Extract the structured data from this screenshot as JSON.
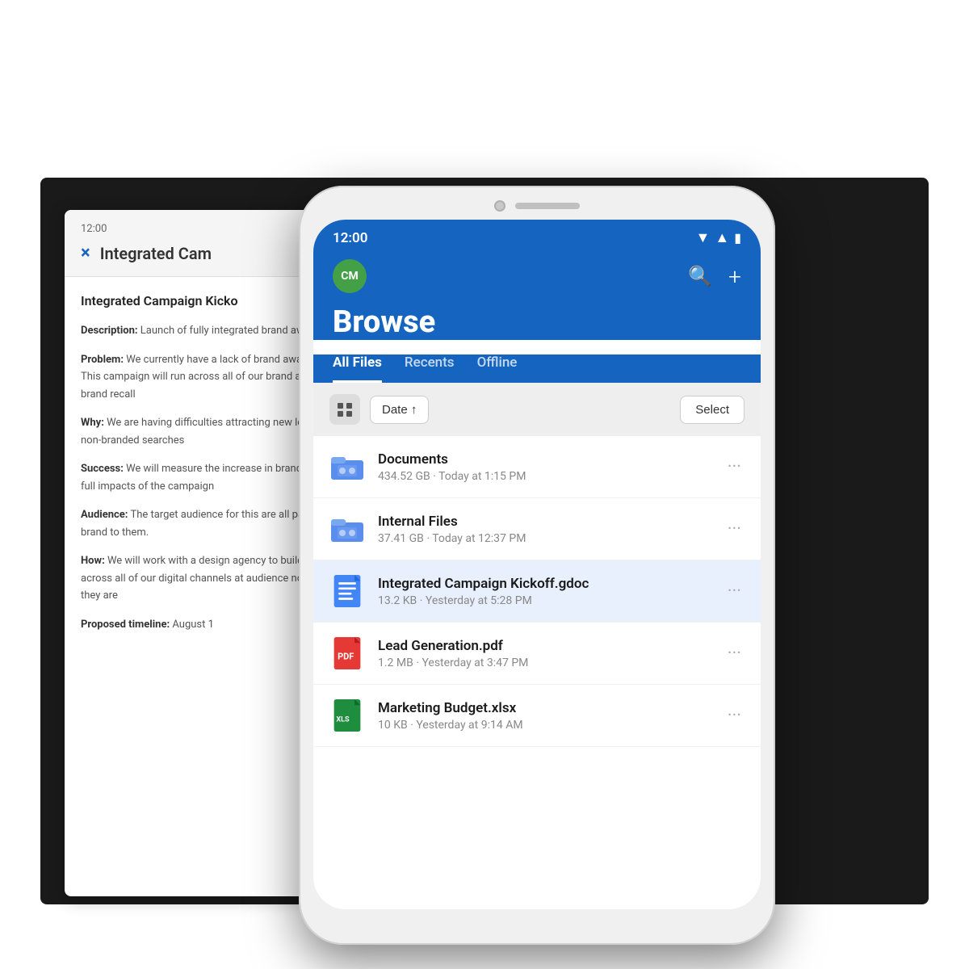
{
  "background": {
    "color": "#1a1a1a"
  },
  "back_document": {
    "time": "12:00",
    "close_label": "×",
    "title": "Integrated Cam",
    "heading": "Integrated Campaign Kicko",
    "sections": [
      {
        "label": "Description:",
        "text": " Launch of fully integrated brand awa channels."
      },
      {
        "label": "Problem:",
        "text": " We currently have a lack of brand aware customers. This campaign will run across all of our brand awareness and brand recall"
      },
      {
        "label": "Why:",
        "text": " We are having difficulties attracting new logo behind our non-branded searches"
      },
      {
        "label": "Success:",
        "text": " We will measure the increase in brande understand the full impacts of the campaign"
      },
      {
        "label": "Audience:",
        "text": " The target audience for this are all pair introduce our brand to them."
      },
      {
        "label": "How:",
        "text": " We will work with a design agency to build a will launch this across all of our digital channels at audience no matter where they are"
      },
      {
        "label": "Proposed timeline:",
        "text": " August 1"
      }
    ]
  },
  "phone": {
    "status_bar": {
      "time": "12:00",
      "wifi": "▼",
      "signal": "▲",
      "battery": "🔋"
    },
    "header": {
      "user_initials": "CM",
      "user_avatar_color": "#43a047",
      "search_label": "search",
      "add_label": "add",
      "title": "Browse"
    },
    "tabs": [
      {
        "label": "All Files",
        "active": true
      },
      {
        "label": "Recents",
        "active": false
      },
      {
        "label": "Offline",
        "active": false
      }
    ],
    "toolbar": {
      "sort_label": "Date ↑",
      "select_label": "Select"
    },
    "files": [
      {
        "id": "documents",
        "name": "Documents",
        "type": "folder",
        "size": "434.52 GB",
        "modified": "Today at 1:15 PM",
        "highlighted": false
      },
      {
        "id": "internal-files",
        "name": "Internal Files",
        "type": "folder",
        "size": "37.41 GB",
        "modified": "Today at 12:37 PM",
        "highlighted": false
      },
      {
        "id": "integrated-campaign",
        "name": "Integrated Campaign Kickoff.gdoc",
        "type": "gdoc",
        "size": "13.2 KB",
        "modified": "Yesterday at 5:28 PM",
        "highlighted": true
      },
      {
        "id": "lead-generation",
        "name": "Lead Generation.pdf",
        "type": "pdf",
        "size": "1.2 MB",
        "modified": "Yesterday at 3:47 PM",
        "highlighted": false
      },
      {
        "id": "marketing-budget",
        "name": "Marketing Budget.xlsx",
        "type": "xlsx",
        "size": "10 KB",
        "modified": "Yesterday at 9:14 AM",
        "highlighted": false
      }
    ]
  }
}
